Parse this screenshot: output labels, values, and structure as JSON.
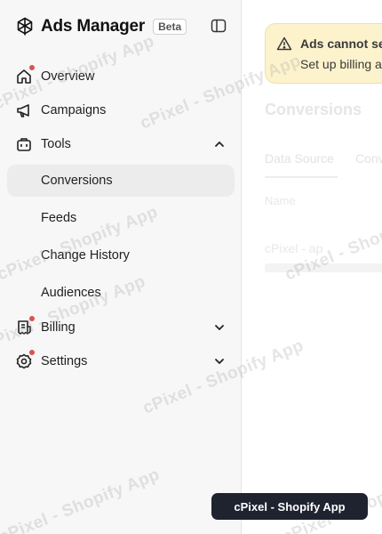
{
  "app": {
    "title": "Ads Manager",
    "badge": "Beta"
  },
  "sidebar": {
    "items": [
      {
        "label": "Overview",
        "icon": "home-icon",
        "has_dot": true
      },
      {
        "label": "Campaigns",
        "icon": "megaphone-icon",
        "has_dot": false
      },
      {
        "label": "Tools",
        "icon": "toolbox-icon",
        "has_dot": false,
        "expanded": true
      },
      {
        "label": "Conversions",
        "active": true
      },
      {
        "label": "Feeds"
      },
      {
        "label": "Change History"
      },
      {
        "label": "Audiences"
      },
      {
        "label": "Billing",
        "icon": "receipt-icon",
        "has_dot": true,
        "expanded": false
      },
      {
        "label": "Settings",
        "icon": "gear-icon",
        "has_dot": true,
        "expanded": false
      }
    ]
  },
  "banner": {
    "title": "Ads cannot se",
    "text": "Set up billing a"
  },
  "main": {
    "title": "Conversions",
    "tabs": [
      "Data Source",
      "Conv"
    ],
    "column_header": "Name",
    "row_name": "cPixel - ap"
  },
  "watermark": "cPixel - Shopify App",
  "toast": {
    "text": "cPixel - Shopify App"
  },
  "colors": {
    "accent_dot": "#d9534f",
    "banner_bg": "#fcf3cd",
    "toast_bg": "#1f2330",
    "sidebar_bg": "#f7f7f7",
    "active_bg": "#ececec"
  }
}
